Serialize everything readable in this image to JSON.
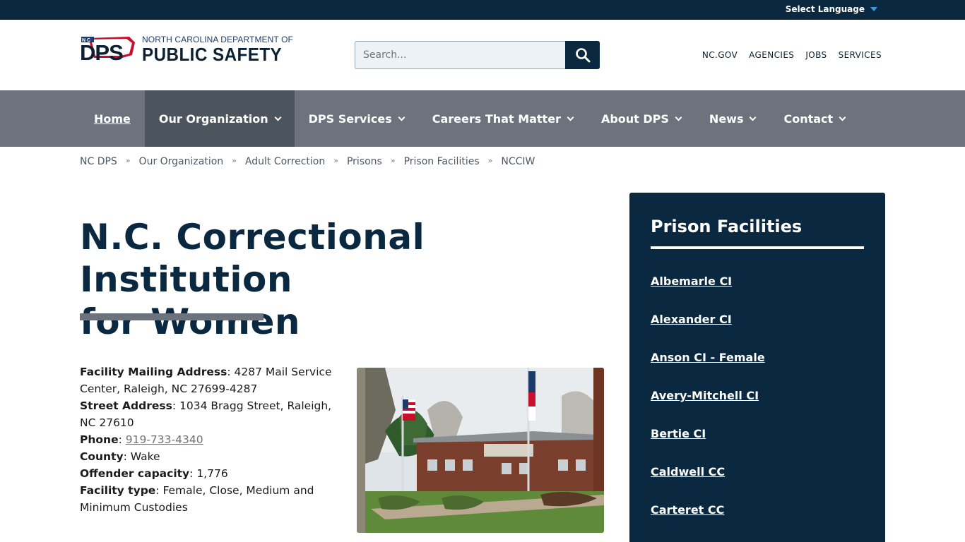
{
  "topbar": {
    "language_label": "Select Language"
  },
  "header": {
    "logo": {
      "mark_text": "DPS",
      "mark_small": "N C",
      "line1": "NORTH CAROLINA DEPARTMENT OF",
      "line2": "PUBLIC SAFETY"
    },
    "search": {
      "placeholder": "Search..."
    },
    "utility_links": [
      "NC.GOV",
      "AGENCIES",
      "JOBS",
      "SERVICES"
    ]
  },
  "nav": {
    "items": [
      {
        "label": "Home",
        "dropdown": false
      },
      {
        "label": "Our Organization",
        "dropdown": true,
        "active": true
      },
      {
        "label": "DPS Services",
        "dropdown": true
      },
      {
        "label": "Careers That Matter",
        "dropdown": true
      },
      {
        "label": "About DPS",
        "dropdown": true
      },
      {
        "label": "News",
        "dropdown": true
      },
      {
        "label": "Contact",
        "dropdown": true
      }
    ]
  },
  "breadcrumb": {
    "items": [
      "NC DPS",
      "Our Organization",
      "Adult Correction",
      "Prisons",
      "Prison Facilities"
    ],
    "separator": "»",
    "current": "NCCIW"
  },
  "page": {
    "title_line1": "N.C. Correctional Institution",
    "title_line2": "for Women"
  },
  "facility": {
    "mailing_label": "Facility Mailing Address",
    "mailing_value": " 4287 Mail Service Center, Raleigh, NC 27699-4287",
    "street_label": "Street Address",
    "street_value": " 1034 Bragg Street, Raleigh, NC 27610",
    "phone_label": "Phone",
    "phone_value": "919-733-4340",
    "county_label": "County",
    "county_value": " Wake",
    "capacity_label": "Offender capacity",
    "capacity_value": " 1,776",
    "type_label": "Facility type",
    "type_value": " Female, Close, Medium and Minimum Custodies"
  },
  "sidebar": {
    "title": "Prison Facilities",
    "links": [
      "Albemarle CI",
      "Alexander CI",
      "Anson CI - Female",
      "Avery-Mitchell CI",
      "Bertie CI",
      "Caldwell CC",
      "Carteret CC"
    ]
  },
  "colors": {
    "navy": "#0b2841",
    "nav_gray": "#6c737c",
    "nav_active": "#4c545e",
    "accent_blue": "#3a9ad9",
    "flag_red": "#c8102e"
  },
  "icons": {
    "search": "search-icon",
    "dropdown": "chevron-down-icon",
    "language_caret": "caret-down-icon"
  }
}
